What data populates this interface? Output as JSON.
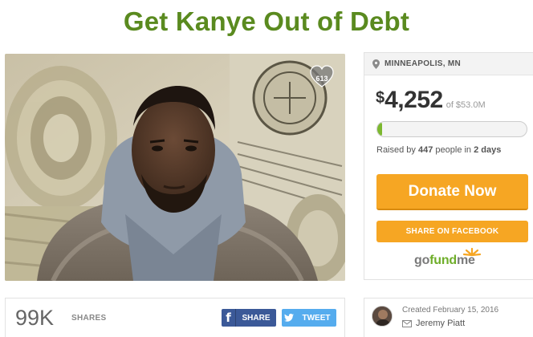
{
  "campaign": {
    "title": "Get Kanye Out of Debt",
    "hearts": "613"
  },
  "panel": {
    "location": "MINNEAPOLIS, MN",
    "currency_symbol": "$",
    "amount_raised": "4,252",
    "goal": "of $53.0M",
    "progress_fraction": 0.02,
    "raised_prefix": "Raised by ",
    "raised_people": "447",
    "raised_middle": " people in ",
    "raised_days": "2 days",
    "donate_label": "Donate Now",
    "share_facebook_label": "SHARE ON FACEBOOK",
    "logo_go": "go",
    "logo_fund": "fund",
    "logo_me": "me"
  },
  "share_bar": {
    "count": "99K",
    "label": "SHARES",
    "facebook_label": "SHARE",
    "twitter_label": "TWEET"
  },
  "organizer": {
    "created": "Created February 15, 2016",
    "name": "Jeremy Piatt"
  },
  "colors": {
    "title_green": "#5a8a1f",
    "donate_orange": "#f6a623",
    "progress_green": "#7cb82f",
    "facebook_blue": "#3b5998",
    "twitter_blue": "#55acee"
  },
  "icons": [
    "heart-icon",
    "location-pin-icon",
    "facebook-f-icon",
    "twitter-bird-icon",
    "envelope-icon",
    "gofundme-logo"
  ]
}
